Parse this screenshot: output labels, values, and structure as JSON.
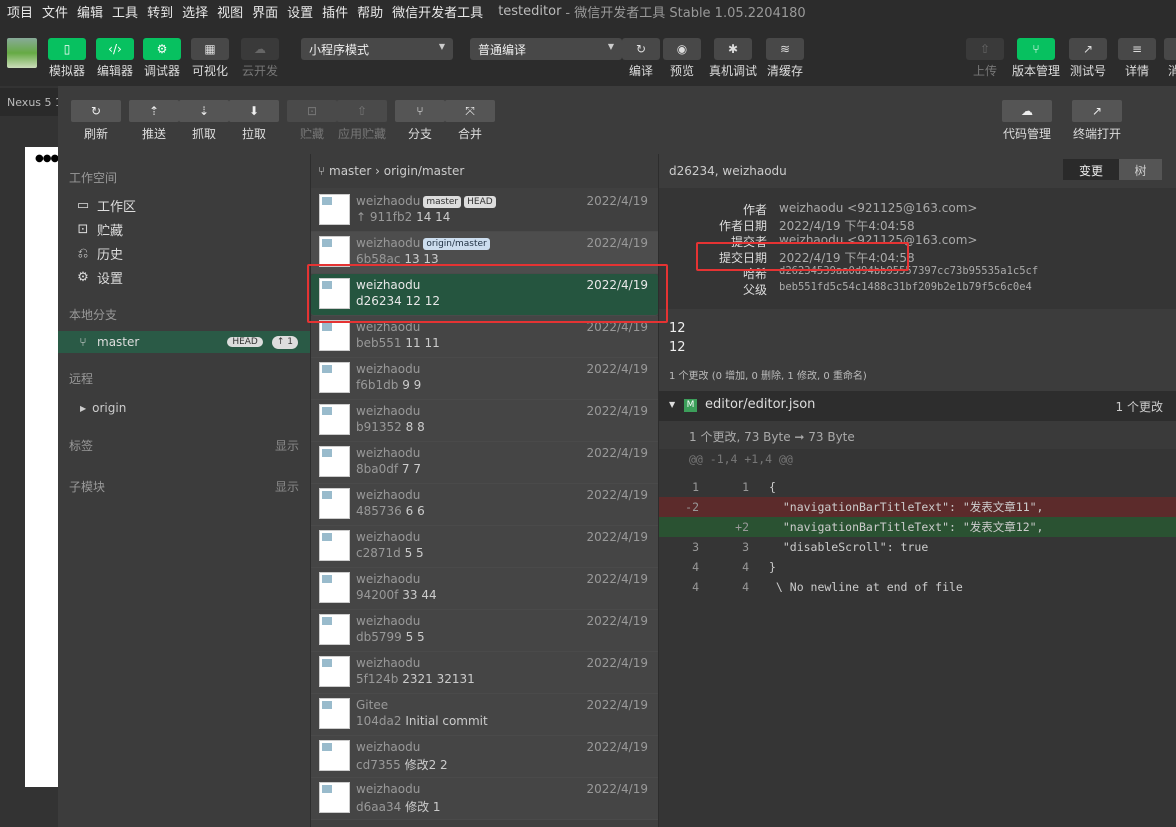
{
  "menubar": {
    "items": [
      "项目",
      "文件",
      "编辑",
      "工具",
      "转到",
      "选择",
      "视图",
      "界面",
      "设置",
      "插件",
      "帮助",
      "微信开发者工具"
    ],
    "title": "testeditor",
    "subtitle": "- 微信开发者工具 Stable 1.05.2204180"
  },
  "toolbar": {
    "simulator": "模拟器",
    "editor": "编辑器",
    "debugger": "调试器",
    "visual": "可视化",
    "cloud": "云开发",
    "mode_select": "小程序模式",
    "compile_select": "普通编译",
    "compile": "编译",
    "preview": "预览",
    "real_debug": "真机调试",
    "clear_cache": "清缓存",
    "upload": "上传",
    "version": "版本管理",
    "test": "测试号",
    "details": "详情",
    "overflow": "消"
  },
  "simulator": {
    "device": "Nexus 5 10"
  },
  "gitbar": {
    "refresh": "刷新",
    "push": "推送",
    "fetch": "抓取",
    "pull": "拉取",
    "stash": "贮藏",
    "apply_stash": "应用贮藏",
    "branch": "分支",
    "merge": "合并",
    "code_manage": "代码管理",
    "terminal_open": "终端打开"
  },
  "sidebar": {
    "workspace_header": "工作空间",
    "workspace_items": [
      {
        "icon": "folder-icon",
        "label": "工作区"
      },
      {
        "icon": "stash-icon",
        "label": "贮藏"
      },
      {
        "icon": "history-icon",
        "label": "历史"
      },
      {
        "icon": "gear-icon",
        "label": "设置"
      }
    ],
    "local_branch_header": "本地分支",
    "branch_name": "master",
    "branch_head": "HEAD",
    "branch_ahead": "↑ 1",
    "remote_header": "远程",
    "remote_name": "origin",
    "tags_header": "标签",
    "tags_show": "显示",
    "submodule_header": "子模块",
    "submodule_show": "显示"
  },
  "commit_list": {
    "branch_path": "master › origin/master",
    "commits": [
      {
        "author": "weizhaodu",
        "hash": "↑ 911fb2",
        "message": "14 14",
        "date": "2022/4/19",
        "tags": [
          "master",
          "HEAD"
        ]
      },
      {
        "author": "weizhaodu",
        "hash": "6b58ac",
        "message": "13 13",
        "date": "2022/4/19",
        "tags": [
          "origin/master"
        ]
      },
      {
        "author": "weizhaodu",
        "hash": "d26234",
        "message": "12 12",
        "date": "2022/4/19",
        "tags": []
      },
      {
        "author": "weizhaodu",
        "hash": "beb551",
        "message": "11 11",
        "date": "2022/4/19",
        "tags": []
      },
      {
        "author": "weizhaodu",
        "hash": "f6b1db",
        "message": "9 9",
        "date": "2022/4/19",
        "tags": []
      },
      {
        "author": "weizhaodu",
        "hash": "b91352",
        "message": "8 8",
        "date": "2022/4/19",
        "tags": []
      },
      {
        "author": "weizhaodu",
        "hash": "8ba0df",
        "message": "7 7",
        "date": "2022/4/19",
        "tags": []
      },
      {
        "author": "weizhaodu",
        "hash": "485736",
        "message": "6 6",
        "date": "2022/4/19",
        "tags": []
      },
      {
        "author": "weizhaodu",
        "hash": "c2871d",
        "message": "5 5",
        "date": "2022/4/19",
        "tags": []
      },
      {
        "author": "weizhaodu",
        "hash": "94200f",
        "message": "33 44",
        "date": "2022/4/19",
        "tags": []
      },
      {
        "author": "weizhaodu",
        "hash": "db5799",
        "message": "5 5",
        "date": "2022/4/19",
        "tags": []
      },
      {
        "author": "weizhaodu",
        "hash": "5f124b",
        "message": "2321 32131",
        "date": "2022/4/19",
        "tags": []
      },
      {
        "author": "Gitee",
        "hash": "104da2",
        "message": "Initial commit",
        "date": "2022/4/19",
        "tags": []
      },
      {
        "author": "weizhaodu",
        "hash": "cd7355",
        "message": "修改2 2",
        "date": "2022/4/19",
        "tags": []
      },
      {
        "author": "weizhaodu",
        "hash": "d6aa34",
        "message": "修改 1",
        "date": "2022/4/19",
        "tags": []
      }
    ]
  },
  "detail": {
    "header": "d26234, weizhaodu",
    "tab_changes": "变更",
    "tab_tree": "树",
    "meta": [
      {
        "key": "作者",
        "value": "weizhaodu <921125@163.com>"
      },
      {
        "key": "作者日期",
        "value": "2022/4/19 下午4:04:58"
      },
      {
        "key": "提交者",
        "value": "weizhaodu <921125@163.com>"
      },
      {
        "key": "提交日期",
        "value": "2022/4/19 下午4:04:58"
      },
      {
        "key": "哈希",
        "value": "d26234539aa0d94bb95557397cc73b95535a1c5cf"
      },
      {
        "key": "父级",
        "value": "beb551fd5c54c1488c31bf209b2e1b79f5c6c0e4"
      }
    ],
    "message_line1": "12",
    "message_line2": "12",
    "summary": "1 个更改 (0 增加, 0 删除, 1 修改, 0 重命名)",
    "file_badge": "M",
    "file_name": "editor/editor.json",
    "file_changes": "1 个更改",
    "size_summary": "1 个更改, 73 Byte ➞ 73 Byte",
    "diff_lines": [
      {
        "n1": "",
        "n2": "",
        "code": "@@ -1,4 +1,4 @@",
        "kind": "hunk"
      },
      {
        "n1": "1",
        "n2": "1",
        "code": "{",
        "kind": "ctx"
      },
      {
        "n1": "-2",
        "n2": "",
        "code": "  \"navigationBarTitleText\": \"发表文章11\",",
        "kind": "del"
      },
      {
        "n1": "",
        "n2": "+2",
        "code": "  \"navigationBarTitleText\": \"发表文章12\",",
        "kind": "add"
      },
      {
        "n1": "3",
        "n2": "3",
        "code": "  \"disableScroll\": true",
        "kind": "ctx"
      },
      {
        "n1": "4",
        "n2": "4",
        "code": "}",
        "kind": "ctx"
      },
      {
        "n1": "4",
        "n2": "4",
        "code": " \\ No newline at end of file",
        "kind": "ctx"
      }
    ]
  }
}
